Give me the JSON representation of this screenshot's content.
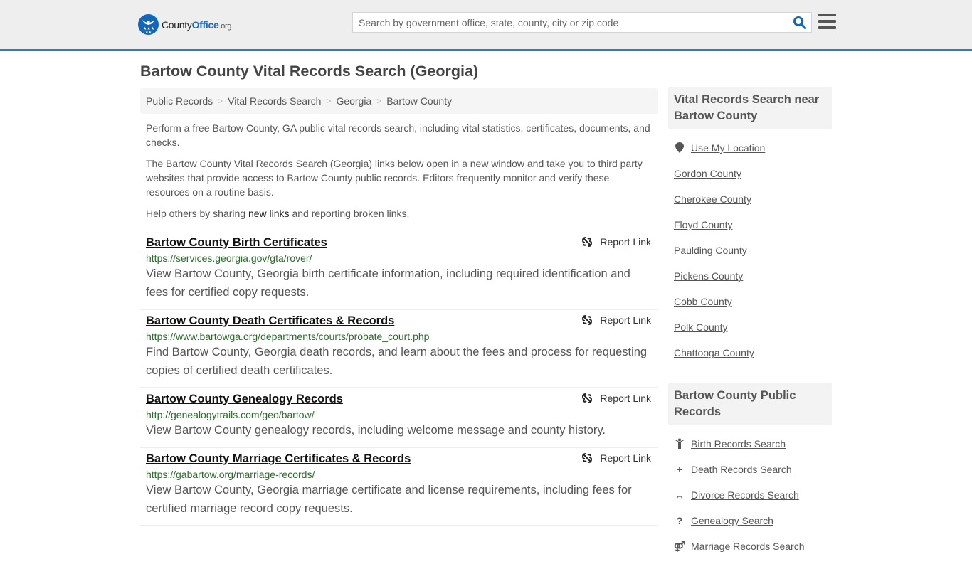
{
  "header": {
    "logo": {
      "brand_a": "County",
      "brand_b": "Office",
      "brand_c": ".org"
    },
    "search_placeholder": "Search by government office, state, county, city or zip code",
    "search_icon": "search-icon",
    "menu_icon": "hamburger-menu-icon"
  },
  "colors": {
    "accent": "#337ab7",
    "brand_blue": "#1565b8",
    "url_green": "#2a6b2a"
  },
  "page_title": "Bartow County Vital Records Search (Georgia)",
  "breadcrumb": [
    {
      "label": "Public Records"
    },
    {
      "label": "Vital Records Search"
    },
    {
      "label": "Georgia"
    },
    {
      "label": "Bartow County"
    }
  ],
  "intro": {
    "p1": "Perform a free Bartow County, GA public vital records search, including vital statistics, certificates, documents, and checks.",
    "p2": "The Bartow County Vital Records Search (Georgia) links below open in a new window and take you to third party websites that provide access to Bartow County public records. Editors frequently monitor and verify these resources on a routine basis.",
    "p3_before": "Help others by sharing ",
    "p3_link": "new links",
    "p3_after": " and reporting broken links."
  },
  "report_label": "Report Link",
  "results": [
    {
      "title": "Bartow County Birth Certificates",
      "url": "https://services.georgia.gov/gta/rover/",
      "desc": "View Bartow County, Georgia birth certificate information, including required identification and fees for certified copy requests."
    },
    {
      "title": "Bartow County Death Certificates & Records",
      "url": "https://www.bartowga.org/departments/courts/probate_court.php",
      "desc": "Find Bartow County, Georgia death records, and learn about the fees and process for requesting copies of certified death certificates."
    },
    {
      "title": "Bartow County Genealogy Records",
      "url": "http://genealogytrails.com/geo/bartow/",
      "desc": "View Bartow County genealogy records, including welcome message and county history."
    },
    {
      "title": "Bartow County Marriage Certificates & Records",
      "url": "https://gabartow.org/marriage-records/",
      "desc": "View Bartow County, Georgia marriage certificate and license requirements, including fees for certified marriage record copy requests."
    }
  ],
  "sidebar": {
    "nearby_heading": "Vital Records Search near Bartow County",
    "use_location": "Use My Location",
    "nearby": [
      "Gordon County",
      "Cherokee County",
      "Floyd County",
      "Paulding County",
      "Pickens County",
      "Cobb County",
      "Polk County",
      "Chattooga County"
    ],
    "public_heading": "Bartow County Public Records",
    "public_links": [
      {
        "label": "Birth Records Search",
        "icon": "child-icon"
      },
      {
        "label": "Death Records Search",
        "icon": "plus-icon"
      },
      {
        "label": "Divorce Records Search",
        "icon": "arrows-horizontal-icon"
      },
      {
        "label": "Genealogy Search",
        "icon": "question-icon"
      },
      {
        "label": "Marriage Records Search",
        "icon": "marriage-icon"
      }
    ]
  }
}
